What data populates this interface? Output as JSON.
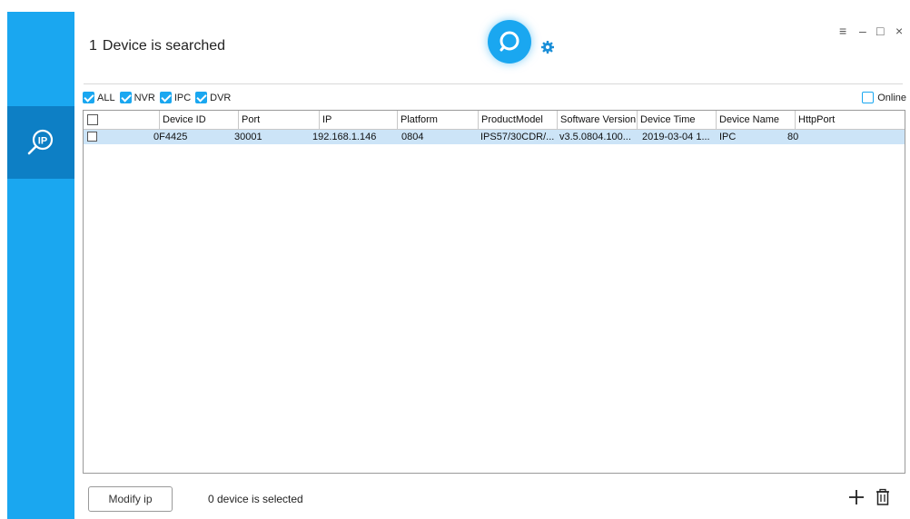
{
  "header": {
    "count": "1",
    "title": "Device is searched"
  },
  "window_controls": {
    "menu": "≡",
    "minimize": "–",
    "maximize": "□",
    "close": "×"
  },
  "filters": [
    {
      "label": "ALL",
      "checked": true
    },
    {
      "label": "NVR",
      "checked": true
    },
    {
      "label": "IPC",
      "checked": true
    },
    {
      "label": "DVR",
      "checked": true
    }
  ],
  "online": {
    "label": "Online",
    "checked": false
  },
  "table": {
    "columns": [
      "Device ID",
      "Port",
      "IP",
      "Platform",
      "ProductModel",
      "Software Version",
      "Device Time",
      "Device Name",
      "HttpPort"
    ],
    "rows": [
      {
        "device_id": "0F4425",
        "port": "30001",
        "ip": "192.168.1.146",
        "platform": "0804",
        "product_model": "IPS57/30CDR/...",
        "software_version": "v3.5.0804.100...",
        "device_time": "2019-03-04 1...",
        "device_name": "IPC",
        "http_port": "80"
      }
    ]
  },
  "footer": {
    "modify_button": "Modify ip",
    "selected_text": "0 device is selected"
  },
  "colors": {
    "accent": "#1aa7f0",
    "sidebar_active": "#0d7fc5",
    "row_selected": "#cce4f7"
  }
}
